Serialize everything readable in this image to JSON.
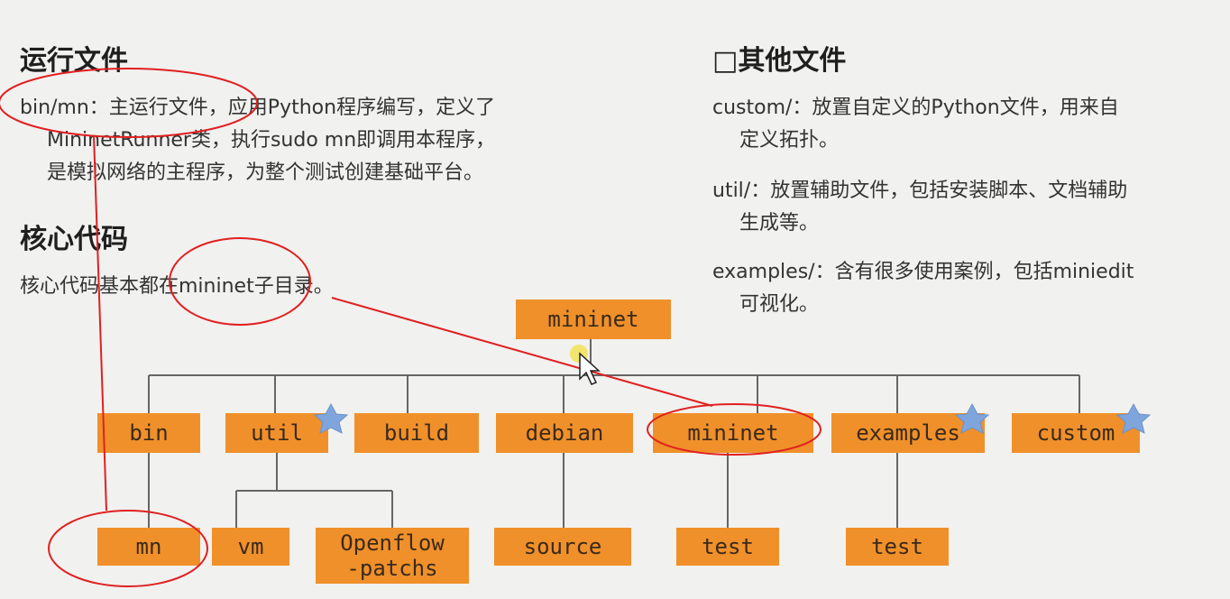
{
  "left": {
    "heading1": "运行文件",
    "para1": {
      "line1": "bin/mn：主运行文件，应用Python程序编写，定义了",
      "line2": "MininetRunner类，执行sudo mn即调用本程序，",
      "line3": "是模拟网络的主程序，为整个测试创建基础平台。"
    },
    "heading2": "核心代码",
    "para2": "核心代码基本都在mininet子目录。"
  },
  "right": {
    "heading": "□其他文件",
    "items": [
      {
        "line1": "custom/：放置自定义的Python文件，用来自",
        "line2": "定义拓扑。"
      },
      {
        "line1": "util/：放置辅助文件，包括安装脚本、文档辅助",
        "line2": "生成等。"
      },
      {
        "line1": "examples/：含有很多使用案例，包括miniedit",
        "line2": "可视化。"
      }
    ]
  },
  "tree": {
    "root": "mininet",
    "children": [
      "bin",
      "util",
      "build",
      "debian",
      "mininet",
      "examples",
      "custom"
    ],
    "grandchildren": {
      "mn": "mn",
      "vm": "vm",
      "openflow_line1": "Openflow",
      "openflow_line2": "-patchs",
      "source": "source",
      "test_mininet": "test",
      "test_examples": "test"
    }
  },
  "colors": {
    "box": "#f0902a",
    "annotation": "#e02020",
    "star": "#7fa6dc",
    "connector": "#666666"
  }
}
